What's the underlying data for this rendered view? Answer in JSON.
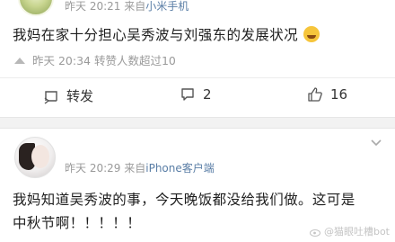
{
  "post1": {
    "meta_time": "昨天 20:21",
    "meta_source_prefix": "来自",
    "meta_source": "小米手机",
    "text": "我妈在家十分担心吴秀波与刘强东的发展状况",
    "repost_note": "昨天 20:34 转赞人数超过10",
    "actions": {
      "repost_label": "转发",
      "comment_count": "2",
      "like_count": "16"
    }
  },
  "post2": {
    "meta_time": "昨天 20:29",
    "meta_source_prefix": "来自",
    "meta_source": "iPhone客户端",
    "text_line1": "我妈知道吴秀波的事，今天晚饭都没给我们做。这可是",
    "text_line2": "中秋节啊！！！！！"
  },
  "watermark": "@猫眼吐槽bot",
  "colors": {
    "source_link": "#5a7ea6",
    "meta_gray": "#9a9a9a",
    "separator_band": "#f2f2f2"
  }
}
